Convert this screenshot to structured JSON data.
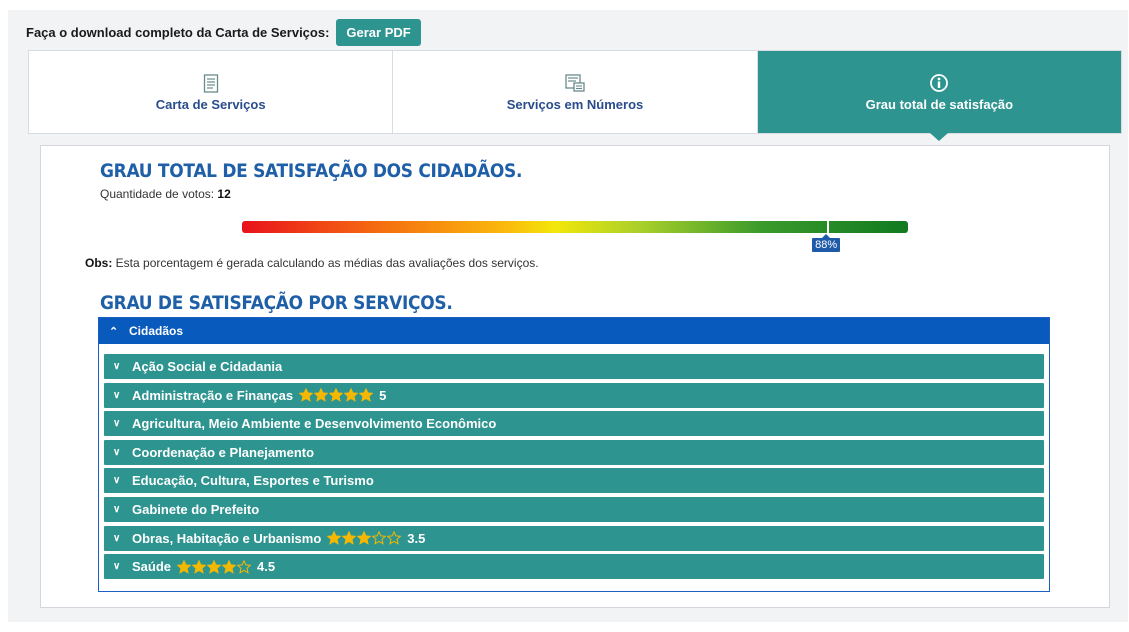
{
  "download": {
    "label": "Faça o download completo da Carta de Serviços:",
    "button": "Gerar PDF"
  },
  "tabs": [
    {
      "label": "Carta de Serviços",
      "icon": "document-icon",
      "active": false
    },
    {
      "label": "Serviços em Números",
      "icon": "stats-icon",
      "active": false
    },
    {
      "label": "Grau total de satisfação",
      "icon": "info-icon",
      "active": true
    }
  ],
  "summary": {
    "title": "GRAU TOTAL DE SATISFAÇÃO DOS CIDADÃOS.",
    "votes_label": "Quantidade de votos: ",
    "votes_value": "12",
    "percent": 88,
    "percent_label": "88%",
    "obs_label": "Obs:",
    "obs_text": " Esta porcentagem é gerada calculando as médias das avaliações dos serviços."
  },
  "services": {
    "title": "GRAU DE SATISFAÇÃO POR SERVIÇOS.",
    "group_label": "Cidadãos",
    "items": [
      {
        "label": "Ação Social e Cidadania",
        "rating": null,
        "rating_label": ""
      },
      {
        "label": "Administração e Finanças",
        "rating": 5,
        "rating_label": "5"
      },
      {
        "label": "Agricultura, Meio Ambiente e Desenvolvimento Econômico",
        "rating": null,
        "rating_label": ""
      },
      {
        "label": "Coordenação e Planejamento",
        "rating": null,
        "rating_label": ""
      },
      {
        "label": "Educação, Cultura, Esportes e Turismo",
        "rating": null,
        "rating_label": ""
      },
      {
        "label": "Gabinete do Prefeito",
        "rating": null,
        "rating_label": ""
      },
      {
        "label": "Obras, Habitação e Urbanismo",
        "rating": 3.5,
        "rating_label": "3.5"
      },
      {
        "label": "Saúde",
        "rating": 4.5,
        "rating_label": "4.5"
      }
    ]
  },
  "colors": {
    "teal": "#2e9490",
    "blue_header": "#085bbd",
    "title_blue": "#1f5fa8",
    "star": "#f5b800"
  }
}
